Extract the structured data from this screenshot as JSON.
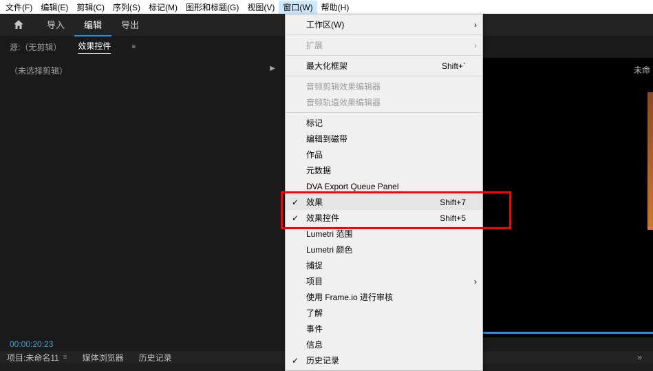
{
  "menubar": {
    "items": [
      "文件(F)",
      "编辑(E)",
      "剪辑(C)",
      "序列(S)",
      "标记(M)",
      "图形和标题(G)",
      "视图(V)",
      "窗口(W)",
      "帮助(H)"
    ]
  },
  "tabnav": {
    "import": "导入",
    "edit": "编辑",
    "export": "导出"
  },
  "panel": {
    "source": "源:（无剪辑）",
    "effects": "效果控件",
    "noclip": "（未选择剪辑）"
  },
  "topright": "未命",
  "timecode": "00:00:20:23",
  "bottom": {
    "project": "项目:未命名11",
    "browser": "媒体浏览器",
    "history": "历史记录"
  },
  "dropdown": {
    "workspace": "工作区(W)",
    "extend": "扩展",
    "maxframe": "最大化框架",
    "maxframe_sc": "Shift+`",
    "audioClipFx": "音频剪辑效果编辑器",
    "audioTrackFx": "音频轨道效果编辑器",
    "marker": "标记",
    "editToTape": "编辑到磁带",
    "work": "作品",
    "metadata": "元数据",
    "dva": "DVA Export Queue Panel",
    "effects": "效果",
    "effects_sc": "Shift+7",
    "effectCtl": "效果控件",
    "effectCtl_sc": "Shift+5",
    "lumetriScope": "Lumetri 范围",
    "lumetriColor": "Lumetri 颜色",
    "capture": "捕捉",
    "project": "项目",
    "frameio": "使用 Frame.io 进行审核",
    "learn": "了解",
    "events": "事件",
    "info": "信息",
    "history": "历史记录"
  }
}
